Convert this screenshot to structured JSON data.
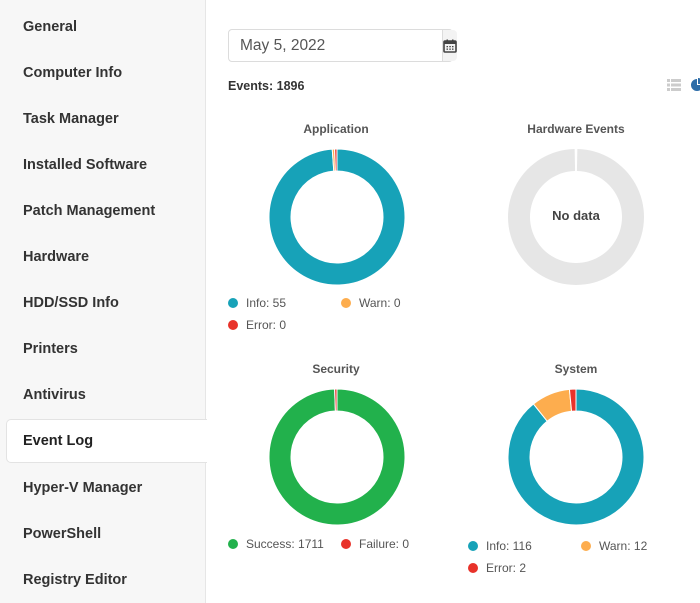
{
  "sidebar": {
    "items": [
      {
        "label": "General",
        "active": false
      },
      {
        "label": "Computer Info",
        "active": false
      },
      {
        "label": "Task Manager",
        "active": false
      },
      {
        "label": "Installed Software",
        "active": false
      },
      {
        "label": "Patch Management",
        "active": false
      },
      {
        "label": "Hardware",
        "active": false
      },
      {
        "label": "HDD/SSD Info",
        "active": false
      },
      {
        "label": "Printers",
        "active": false
      },
      {
        "label": "Antivirus",
        "active": false
      },
      {
        "label": "Event Log",
        "active": true
      },
      {
        "label": "Hyper-V Manager",
        "active": false
      },
      {
        "label": "PowerShell",
        "active": false
      },
      {
        "label": "Registry Editor",
        "active": false
      }
    ]
  },
  "toolbar": {
    "date_value": "May 5, 2022",
    "calendar_icon": "calendar-icon",
    "events_label": "Events: 1896",
    "view_icons": [
      "list-icon",
      "pie-chart-icon"
    ]
  },
  "colors": {
    "info": "#17a2b8",
    "warn": "#fdad4e",
    "error": "#e8322a",
    "success": "#22b14c",
    "nodata": "#e6e6e6"
  },
  "chart_data": [
    {
      "type": "pie",
      "title": "Application",
      "slices": [
        {
          "label": "Info",
          "value": 55,
          "color": "#17a2b8"
        },
        {
          "label": "Warn",
          "value": 0,
          "color": "#fdad4e"
        },
        {
          "label": "Error",
          "value": 0,
          "color": "#e8322a"
        }
      ],
      "legend": [
        "Info: 55",
        "Warn: 0",
        "Error: 0"
      ]
    },
    {
      "type": "pie",
      "title": "Hardware Events",
      "slices": [],
      "empty_text": "No data",
      "legend": []
    },
    {
      "type": "pie",
      "title": "Security",
      "slices": [
        {
          "label": "Success",
          "value": 1711,
          "color": "#22b14c"
        },
        {
          "label": "Failure",
          "value": 0,
          "color": "#e8322a"
        }
      ],
      "legend": [
        "Success: 1711",
        "Failure: 0"
      ]
    },
    {
      "type": "pie",
      "title": "System",
      "slices": [
        {
          "label": "Info",
          "value": 116,
          "color": "#17a2b8"
        },
        {
          "label": "Warn",
          "value": 12,
          "color": "#fdad4e"
        },
        {
          "label": "Error",
          "value": 2,
          "color": "#e8322a"
        }
      ],
      "legend": [
        "Info: 116",
        "Warn: 12",
        "Error: 2"
      ]
    }
  ]
}
